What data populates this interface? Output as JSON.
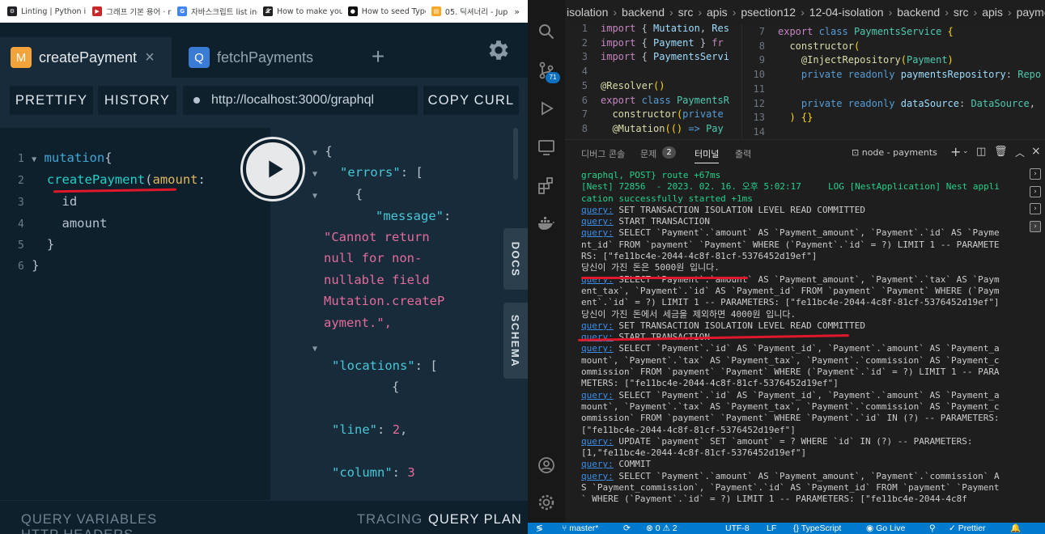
{
  "bookmarks": [
    {
      "label": "Linting | Python in...",
      "color": "#202124",
      "glyph": "⚙"
    },
    {
      "label": "그래프 기본 용어 · ra...",
      "color": "#c62828",
      "glyph": "▶"
    },
    {
      "label": "자바스크립트 list ind...",
      "color": "#4285f4",
      "glyph": "G"
    },
    {
      "label": "How to make your...",
      "color": "#222222",
      "glyph": "𝓧"
    },
    {
      "label": "How to seed Type...",
      "color": "#111111",
      "glyph": "●"
    },
    {
      "label": "05. 딕셔너리 - Jupy...",
      "color": "#f9a825",
      "glyph": "▤"
    }
  ],
  "bookmarks_more": "»",
  "playground": {
    "tabs": [
      {
        "badge": "M",
        "badge_color": "#f2a33a",
        "label": "createPayment",
        "close": "×"
      },
      {
        "badge": "Q",
        "badge_color": "#3a7bd5",
        "label": "fetchPayments"
      }
    ],
    "add_tab": "+",
    "toolbar": {
      "prettify": "PRETTIFY",
      "history": "HISTORY",
      "url": "http://localhost:3000/graphql",
      "copy_curl": "COPY CURL"
    },
    "query": {
      "line1_kw": "mutation",
      "line1_brace": "{",
      "line2_fn": "createPayment",
      "line2_paren": "(",
      "line2_arg": "amount",
      "line2_colon": ":",
      "line3": "id",
      "line4": "amount",
      "line5": "}",
      "line6": "}",
      "line_numbers": [
        "1",
        "2",
        "3",
        "4",
        "5",
        "6"
      ]
    },
    "result": {
      "open_brace": "{",
      "errors_key": "\"errors\"",
      "colon": ":",
      "open_bracket": "[",
      "item_brace": "{",
      "message_key": "\"message\"",
      "message_lines": [
        "\"Cannot return",
        "null for non-",
        "nullable field",
        "Mutation.createP",
        "ayment.\","
      ],
      "locations_key": "\"locations\"",
      "loc_brace": "{",
      "line_key": "\"line\"",
      "line_val": "2",
      "column_key": "\"column\"",
      "column_val": "3",
      "comma": ","
    },
    "side_tabs": {
      "docs": "DOCS",
      "schema": "SCHEMA"
    },
    "bottom": {
      "query_variables": "QUERY VARIABLES",
      "http_headers": "HTTP HEADERS",
      "tracing": "TRACING",
      "query_plan": "QUERY PLAN"
    }
  },
  "vscode": {
    "breadcrumb": [
      "isolation",
      "backend",
      "src",
      "apis",
      "psection12",
      "12-04-isolation",
      "backend",
      "src",
      "apis",
      "payments"
    ],
    "scm_badge": "71",
    "left_code": [
      {
        "n": "1",
        "parts": [
          [
            "imp",
            "import "
          ],
          [
            "pn",
            "{ "
          ],
          [
            "var",
            "Mutation"
          ],
          [
            "pn",
            ", "
          ],
          [
            "var",
            "Res"
          ]
        ]
      },
      {
        "n": "2",
        "parts": [
          [
            "imp",
            "import "
          ],
          [
            "pn",
            "{ "
          ],
          [
            "var",
            "Payment"
          ],
          [
            "pn",
            " } "
          ],
          [
            "imp",
            "fr"
          ]
        ]
      },
      {
        "n": "3",
        "parts": [
          [
            "imp",
            "import "
          ],
          [
            "pn",
            "{ "
          ],
          [
            "var",
            "PaymentsServi"
          ]
        ]
      },
      {
        "n": "4",
        "parts": []
      },
      {
        "n": "5",
        "parts": [
          [
            "fnc",
            "@Resolver"
          ],
          [
            "brc",
            "()"
          ]
        ]
      },
      {
        "n": "6",
        "parts": [
          [
            "imp",
            "export "
          ],
          [
            "kwd",
            "class "
          ],
          [
            "cls",
            "PaymentsR"
          ]
        ]
      },
      {
        "n": "7",
        "parts": [
          [
            "pn",
            "  "
          ],
          [
            "fnc",
            "constructor"
          ],
          [
            "brc",
            "("
          ],
          [
            "kwd",
            "private"
          ]
        ]
      },
      {
        "n": "8",
        "parts": [
          [
            "pn",
            "  "
          ],
          [
            "fnc",
            "@Mutation"
          ],
          [
            "brc",
            "(()"
          ],
          [
            "kwd",
            " => "
          ],
          [
            "cls",
            "Pay"
          ]
        ]
      }
    ],
    "right_code": [
      {
        "n": "7",
        "parts": [
          [
            "imp",
            "export "
          ],
          [
            "kwd",
            "class "
          ],
          [
            "cls",
            "PaymentsService "
          ],
          [
            "brc",
            "{"
          ]
        ]
      },
      {
        "n": "8",
        "parts": [
          [
            "pn",
            "  "
          ],
          [
            "fnc",
            "constructor"
          ],
          [
            "brc",
            "("
          ]
        ]
      },
      {
        "n": "9",
        "parts": [
          [
            "pn",
            "    "
          ],
          [
            "fnc",
            "@InjectRepository"
          ],
          [
            "brc",
            "("
          ],
          [
            "cls",
            "Payment"
          ],
          [
            "brc",
            ")"
          ]
        ]
      },
      {
        "n": "10",
        "parts": [
          [
            "pn",
            "    "
          ],
          [
            "kwd",
            "private readonly "
          ],
          [
            "var",
            "paymentsRepository"
          ],
          [
            "pn",
            ": "
          ],
          [
            "cls",
            "Repo"
          ]
        ]
      },
      {
        "n": "11",
        "parts": []
      },
      {
        "n": "12",
        "parts": [
          [
            "pn",
            "    "
          ],
          [
            "kwd",
            "private readonly "
          ],
          [
            "var",
            "dataSource"
          ],
          [
            "pn",
            ": "
          ],
          [
            "cls",
            "DataSource"
          ],
          [
            "pn",
            ","
          ]
        ]
      },
      {
        "n": "13",
        "parts": [
          [
            "pn",
            "  "
          ],
          [
            "brc",
            ") {}"
          ]
        ]
      },
      {
        "n": "14",
        "parts": []
      }
    ],
    "panel_tabs": {
      "debug": "디버그 콘솔",
      "problems": "문제",
      "problems_count": "2",
      "terminal": "터미널",
      "output": "출력",
      "terminal_name": "node - payments"
    },
    "terminal_lines": [
      {
        "t": "graphql, POST} route +67ms",
        "cls": "ok"
      },
      {
        "t": "[Nest] 72856  - 2023. 02. 16. 오후 5:02:17     LOG [NestApplication] Nest application successfully started +1ms",
        "cls": "ok"
      },
      {
        "q": "query:",
        "t": " SET TRANSACTION ISOLATION LEVEL READ COMMITTED"
      },
      {
        "q": "query:",
        "t": " START TRANSACTION"
      },
      {
        "q": "query:",
        "t": " SELECT `Payment`.`amount` AS `Payment_amount`, `Payment`.`id` AS `Payment_id` FROM `payment` `Payment` WHERE (`Payment`.`id` = ?) LIMIT 1 -- PARAMETERS: [\"fe11bc4e-2044-4c8f-81cf-5376452d19ef\"]"
      },
      {
        "t": "당신이 가진 돈은 5000원 입니다."
      },
      {
        "q": "query:",
        "t": " SELECT `Payment`.`amount` AS `Payment_amount`, `Payment`.`tax` AS `Payment_tax`, `Payment`.`id` AS `Payment_id` FROM `payment` `Payment` WHERE (`Payment`.`id` = ?) LIMIT 1 -- PARAMETERS: [\"fe11bc4e-2044-4c8f-81cf-5376452d19ef\"]"
      },
      {
        "t": "당신이 가진 돈에서 세금을 제외하면 4000원 입니다."
      },
      {
        "q": "query:",
        "t": " SET TRANSACTION ISOLATION LEVEL READ COMMITTED"
      },
      {
        "q": "query:",
        "t": " START TRANSACTION"
      },
      {
        "q": "query:",
        "t": " SELECT `Payment`.`id` AS `Payment_id`, `Payment`.`amount` AS `Payment_amount`, `Payment`.`tax` AS `Payment_tax`, `Payment`.`commission` AS `Payment_commission` FROM `payment` `Payment` WHERE (`Payment`.`id` = ?) LIMIT 1 -- PARAMETERS: [\"fe11bc4e-2044-4c8f-81cf-5376452d19ef\"]"
      },
      {
        "q": "query:",
        "t": " SELECT `Payment`.`id` AS `Payment_id`, `Payment`.`amount` AS `Payment_amount`, `Payment`.`tax` AS `Payment_tax`, `Payment`.`commission` AS `Payment_commission` FROM `payment` `Payment` WHERE `Payment`.`id` IN (?) -- PARAMETERS: [\"fe11bc4e-2044-4c8f-81cf-5376452d19ef\"]"
      },
      {
        "q": "query:",
        "t": " UPDATE `payment` SET `amount` = ? WHERE `id` IN (?) -- PARAMETERS: [1,\"fe11bc4e-2044-4c8f-81cf-5376452d19ef\"]"
      },
      {
        "q": "query:",
        "t": " COMMIT"
      },
      {
        "q": "query:",
        "t": " SELECT `Payment`.`amount` AS `Payment_amount`, `Payment`.`commission` AS `Payment_commission`, `Payment`.`id` AS `Payment_id` FROM `payment` `Payment` WHERE (`Payment`.`id` = ?) LIMIT 1 -- PARAMETERS: [\"fe11bc4e-2044-4c8f"
      }
    ],
    "status": {
      "branch": "master*",
      "errors": "⊗ 0 ⚠ 2",
      "encoding": "UTF-8",
      "eol": "LF",
      "language": "{} TypeScript",
      "golive": "Go Live",
      "prettier": "✓ Prettier"
    }
  }
}
